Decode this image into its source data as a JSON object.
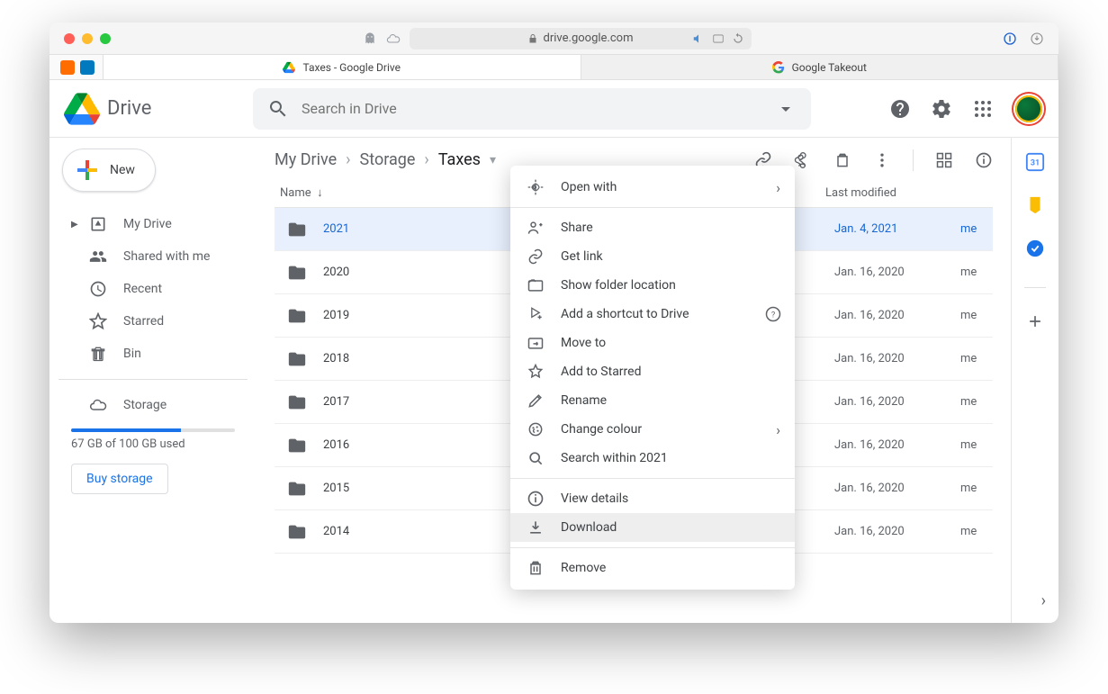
{
  "browser": {
    "url_host": "drive.google.com",
    "tabs": [
      {
        "label": "Taxes - Google Drive",
        "active": true
      },
      {
        "label": "Google Takeout",
        "active": false
      }
    ]
  },
  "header": {
    "app_name": "Drive",
    "search_placeholder": "Search in Drive"
  },
  "sidebar": {
    "new_label": "New",
    "items": [
      {
        "id": "my-drive",
        "label": "My Drive"
      },
      {
        "id": "shared",
        "label": "Shared with me"
      },
      {
        "id": "recent",
        "label": "Recent"
      },
      {
        "id": "starred",
        "label": "Starred"
      },
      {
        "id": "bin",
        "label": "Bin"
      }
    ],
    "storage_label": "Storage",
    "storage_text": "67 GB of 100 GB used",
    "storage_percent": 67,
    "buy_label": "Buy storage"
  },
  "breadcrumb": [
    "My Drive",
    "Storage",
    "Taxes"
  ],
  "columns": {
    "name": "Name",
    "modified": "Last modified"
  },
  "rows": [
    {
      "name": "2021",
      "date": "Jan. 4, 2021",
      "owner": "me",
      "selected": true
    },
    {
      "name": "2020",
      "date": "Jan. 16, 2020",
      "owner": "me"
    },
    {
      "name": "2019",
      "date": "Jan. 16, 2020",
      "owner": "me"
    },
    {
      "name": "2018",
      "date": "Jan. 16, 2020",
      "owner": "me"
    },
    {
      "name": "2017",
      "date": "Jan. 16, 2020",
      "owner": "me"
    },
    {
      "name": "2016",
      "date": "Jan. 16, 2020",
      "owner": "me"
    },
    {
      "name": "2015",
      "date": "Jan. 16, 2020",
      "owner": "me"
    },
    {
      "name": "2014",
      "date": "Jan. 16, 2020",
      "owner": "me"
    }
  ],
  "context_menu": {
    "groups": [
      [
        {
          "id": "open-with",
          "label": "Open with",
          "submenu": true
        }
      ],
      [
        {
          "id": "share",
          "label": "Share"
        },
        {
          "id": "get-link",
          "label": "Get link"
        },
        {
          "id": "show-location",
          "label": "Show folder location"
        },
        {
          "id": "add-shortcut",
          "label": "Add a shortcut to Drive",
          "help": true
        },
        {
          "id": "move-to",
          "label": "Move to"
        },
        {
          "id": "add-starred",
          "label": "Add to Starred"
        },
        {
          "id": "rename",
          "label": "Rename"
        },
        {
          "id": "change-colour",
          "label": "Change colour",
          "submenu": true
        },
        {
          "id": "search-within",
          "label": "Search within 2021"
        }
      ],
      [
        {
          "id": "view-details",
          "label": "View details"
        },
        {
          "id": "download",
          "label": "Download",
          "hover": true
        }
      ],
      [
        {
          "id": "remove",
          "label": "Remove"
        }
      ]
    ]
  }
}
